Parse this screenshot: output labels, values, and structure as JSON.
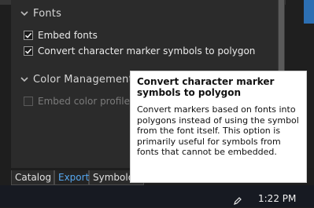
{
  "sections": {
    "fonts": {
      "label": "Fonts",
      "chevron": "chevron-down-icon"
    },
    "color_management": {
      "label": "Color Management",
      "chevron": "chevron-down-icon"
    }
  },
  "options": {
    "embed_fonts": {
      "label": "Embed fonts",
      "checked": true
    },
    "convert_markers": {
      "label": "Convert character marker symbols to polygon",
      "checked": true
    },
    "embed_color_profile": {
      "label": "Embed color profile",
      "checked": false,
      "enabled": false
    }
  },
  "tooltip": {
    "title": "Convert character marker symbols to polygon",
    "body": "Convert markers based on fonts into polygons instead of using the symbol from the font itself. This option is primarily useful for symbols from fonts that cannot be embedded."
  },
  "tabs": [
    {
      "label": "Catalog",
      "active": false
    },
    {
      "label": "Export",
      "active": true
    },
    {
      "label": "Symbology",
      "active": false
    }
  ],
  "taskbar": {
    "time": "1:22 PM",
    "pen_icon": "pen-icon"
  },
  "colors": {
    "accent": "#56a8f0",
    "panel": "#2b2b2b",
    "tooltip_bg": "#ffffff"
  }
}
